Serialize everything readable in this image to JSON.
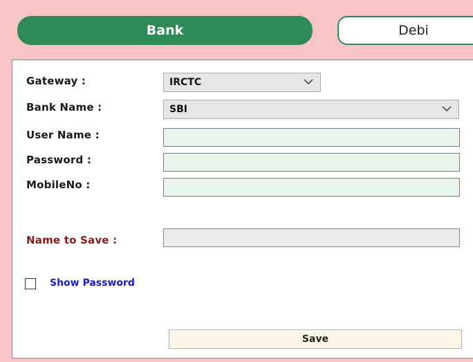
{
  "tabs": {
    "bank": "Bank",
    "debit": "Debi"
  },
  "form": {
    "gateway_label": "Gateway :",
    "gateway_value": "IRCTC",
    "bank_name_label": "Bank Name :",
    "bank_name_value": "SBI",
    "username_label": "User Name :",
    "password_label": "Password :",
    "mobile_label": "MobileNo :",
    "name_to_save_label": "Name to Save :",
    "show_password_label": "Show Password",
    "save_label": "Save"
  },
  "icons": {
    "dropdown": "chevron-down-icon"
  },
  "colors": {
    "background": "#f9c4c4",
    "bank_tab": "#2e8b57",
    "input_fill": "#e8f6ec",
    "accent_label": "#8b1a1a",
    "link_text": "#1a1acc"
  }
}
